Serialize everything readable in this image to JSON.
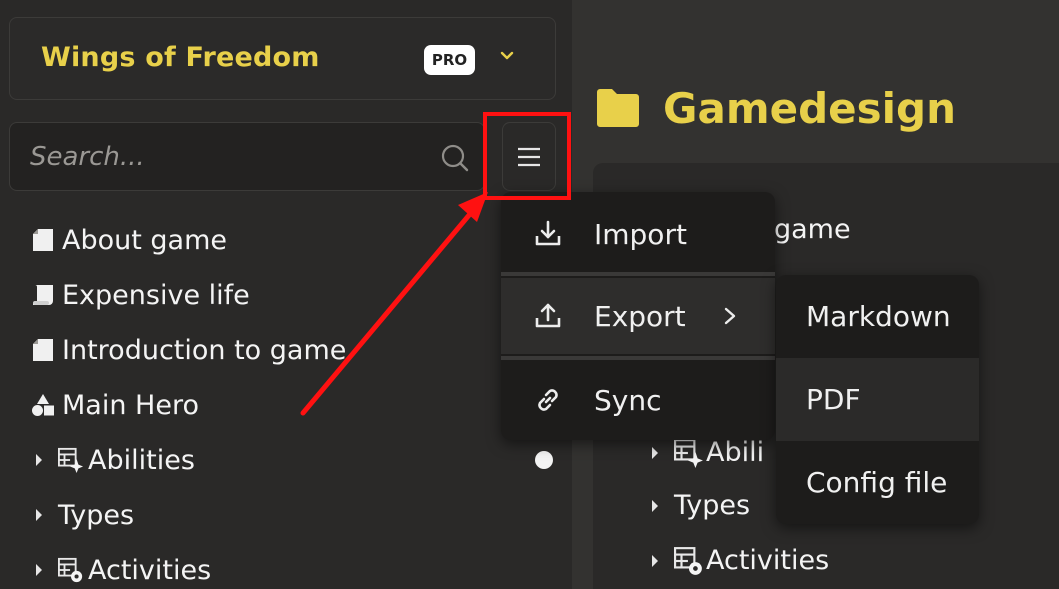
{
  "workspace": {
    "name": "Wings of Freedom",
    "badge": "PRO"
  },
  "search": {
    "placeholder": "Search..."
  },
  "tree": {
    "items": [
      {
        "label": "About game"
      },
      {
        "label": "Expensive life"
      },
      {
        "label": "Introduction to game"
      },
      {
        "label": "Main Hero"
      },
      {
        "label": "Abilities"
      },
      {
        "label": "Types"
      },
      {
        "label": "Activities"
      }
    ]
  },
  "main": {
    "title": "Gamedesign",
    "items": [
      {
        "label": "game"
      },
      {
        "label": "Abili"
      },
      {
        "label": "Types"
      },
      {
        "label": "Activities"
      }
    ]
  },
  "menu": {
    "items": [
      {
        "label": "Import"
      },
      {
        "label": "Export"
      },
      {
        "label": "Sync"
      }
    ]
  },
  "export_submenu": {
    "items": [
      {
        "label": "Markdown"
      },
      {
        "label": "PDF"
      },
      {
        "label": "Config file"
      }
    ]
  },
  "colors": {
    "accent": "#e8d04a",
    "annotation": "#ff1111",
    "background": "#2a2928"
  }
}
